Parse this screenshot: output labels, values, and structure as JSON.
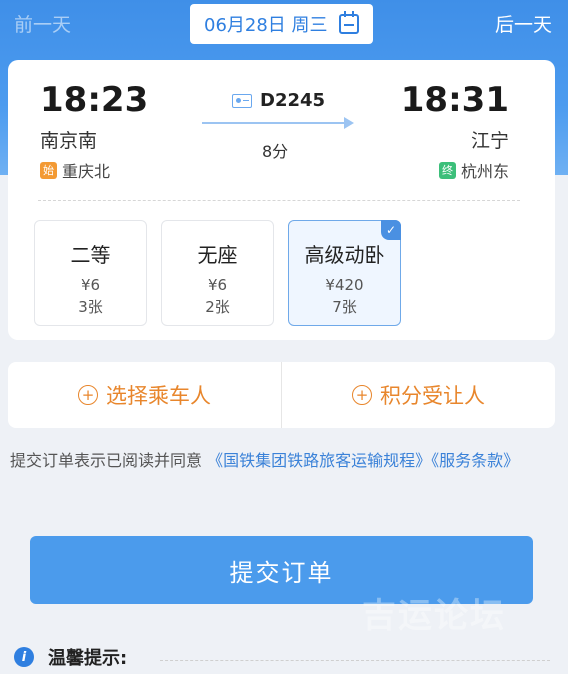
{
  "nav": {
    "prev_day": "前一天",
    "next_day": "后一天",
    "date": "06月28日 周三"
  },
  "train": {
    "number": "D2245",
    "departure": {
      "time": "18:23",
      "station": "南京南",
      "origin_tag": "始",
      "origin_station": "重庆北"
    },
    "arrival": {
      "time": "18:31",
      "station": "江宁",
      "terminus_tag": "终",
      "terminus_station": "杭州东"
    },
    "duration": "8分"
  },
  "seats": [
    {
      "name": "二等",
      "price": "¥6",
      "count": "3张",
      "selected": false
    },
    {
      "name": "无座",
      "price": "¥6",
      "count": "2张",
      "selected": false
    },
    {
      "name": "高级动卧",
      "price": "¥420",
      "count": "7张",
      "selected": true
    }
  ],
  "passenger": {
    "select_label": "选择乘车人",
    "points_label": "积分受让人"
  },
  "agreement": {
    "prefix": "提交订单表示已阅读并同意",
    "link_rules": "《国铁集团铁路旅客运输规程》",
    "link_terms": "《服务条款》"
  },
  "submit_label": "提交订单",
  "tips_title": "温馨提示:",
  "watermark": "吉运论坛",
  "colors": {
    "primary": "#4b9bec",
    "accent_orange": "#e8862c",
    "origin_tag": "#f39a34",
    "terminus_tag": "#3cbf7a"
  }
}
